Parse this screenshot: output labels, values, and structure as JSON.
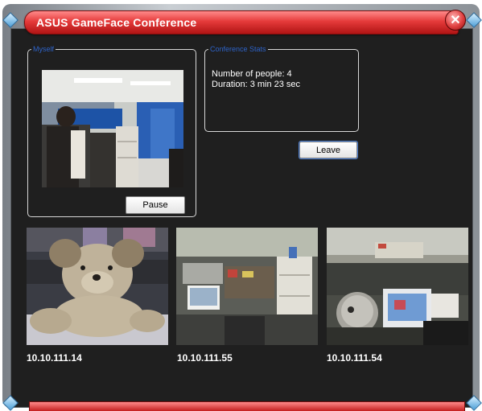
{
  "window": {
    "title": "ASUS GameFace Conference"
  },
  "myself": {
    "legend": "Myself",
    "pause_label": "Pause"
  },
  "stats": {
    "legend": "Conference Stats",
    "people_line": "Number of people: 4",
    "duration_line": "Duration: 3 min 23 sec",
    "leave_label": "Leave"
  },
  "participants": [
    {
      "ip": "10.10.111.14"
    },
    {
      "ip": "10.10.111.55"
    },
    {
      "ip": "10.10.111.54"
    }
  ],
  "icons": {
    "close": "close-icon"
  },
  "colors": {
    "title_red": "#e53a3a",
    "panel_bg": "#1f1f1f",
    "legend_blue": "#2e63c8"
  }
}
